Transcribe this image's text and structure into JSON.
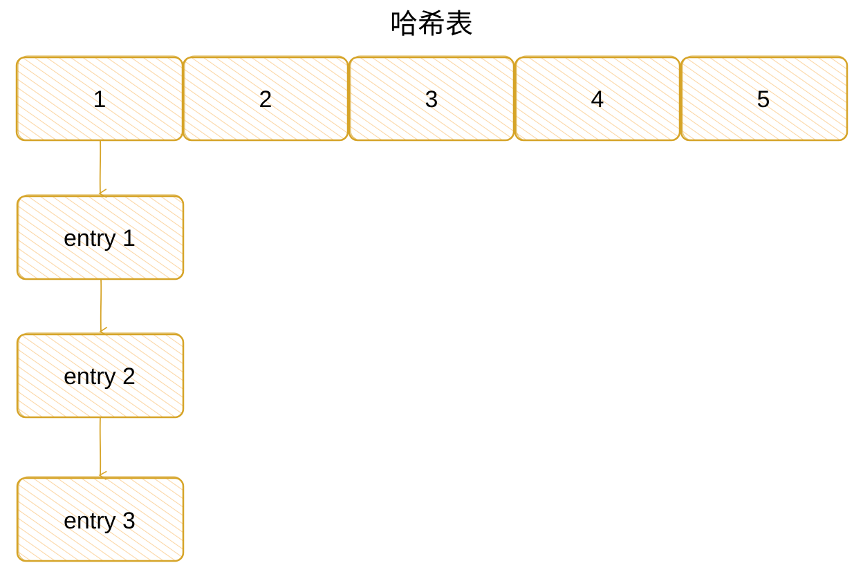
{
  "title": "哈希表",
  "buckets": [
    {
      "label": "1"
    },
    {
      "label": "2"
    },
    {
      "label": "3"
    },
    {
      "label": "4"
    },
    {
      "label": "5"
    }
  ],
  "chain": [
    {
      "label": "entry 1"
    },
    {
      "label": "entry 2"
    },
    {
      "label": "entry 3"
    }
  ],
  "colors": {
    "stroke": "#d6a428",
    "fill": "#fde9c8",
    "text": "#000000"
  }
}
